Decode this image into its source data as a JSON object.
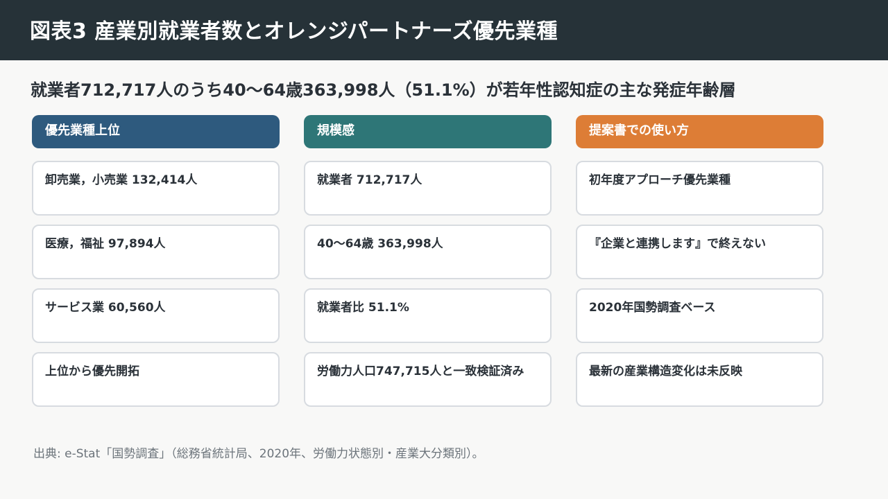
{
  "header": {
    "title": "図表3 産業別就業者数とオレンジパートナーズ優先業種"
  },
  "subtitle": "就業者712,717人のうち40〜64歳363,998人（51.1%）が若年性認知症の主な発症年齢層",
  "columns": [
    {
      "title": "優先業種上位",
      "color": "#2e5a7e",
      "items": [
        "卸売業，小売業 132,414人",
        "医療，福祉 97,894人",
        "サービス業 60,560人",
        "上位から優先開拓"
      ]
    },
    {
      "title": "規模感",
      "color": "#2e7677",
      "items": [
        "就業者 712,717人",
        "40〜64歳 363,998人",
        "就業者比 51.1%",
        "労働力人口747,715人と一致検証済み"
      ]
    },
    {
      "title": "提案書での使い方",
      "color": "#dd7d36",
      "items": [
        "初年度アプローチ優先業種",
        "『企業と連携します』で終えない",
        "2020年国勢調査ベース",
        "最新の産業構造変化は未反映"
      ]
    }
  ],
  "source": "出典: e-Stat「国勢調査」（総務省統計局、2020年、労働力状態別・産業大分類別）。"
}
